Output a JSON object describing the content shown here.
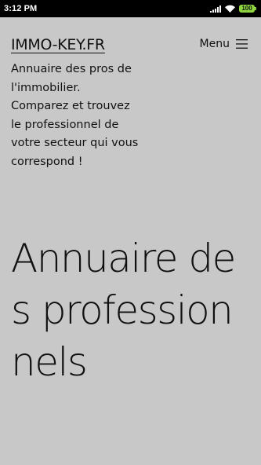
{
  "status_bar": {
    "time": "3:12 PM",
    "battery": "100",
    "icons": [
      "signal-icon",
      "wifi-icon",
      "battery-icon"
    ]
  },
  "header": {
    "site_title": "IMMO-KEY.FR",
    "menu_label": "Menu",
    "menu_icon": "hamburger-icon"
  },
  "tagline": "Annuaire des pros de l'immobilier. Comparez et trouvez le professionnel de votre secteur qui vous correspond !",
  "hero": {
    "title": "Annuaire des professionnels"
  },
  "colors": {
    "background": "#c8c8c8",
    "status_bar": "#000000",
    "text": "#111111",
    "battery": "#8dd63f"
  }
}
